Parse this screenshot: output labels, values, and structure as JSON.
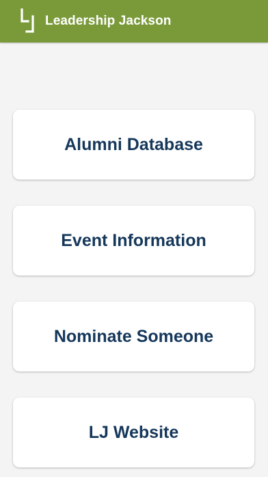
{
  "header": {
    "title": "Leadership Jackson",
    "logo_icon": "lj-logo-icon",
    "background_color": "#7a9a3a"
  },
  "menu": {
    "items": [
      {
        "label": "Alumni Database"
      },
      {
        "label": "Event Information"
      },
      {
        "label": "Nominate Someone"
      },
      {
        "label": "LJ Website"
      }
    ],
    "label_color": "#15375a"
  }
}
